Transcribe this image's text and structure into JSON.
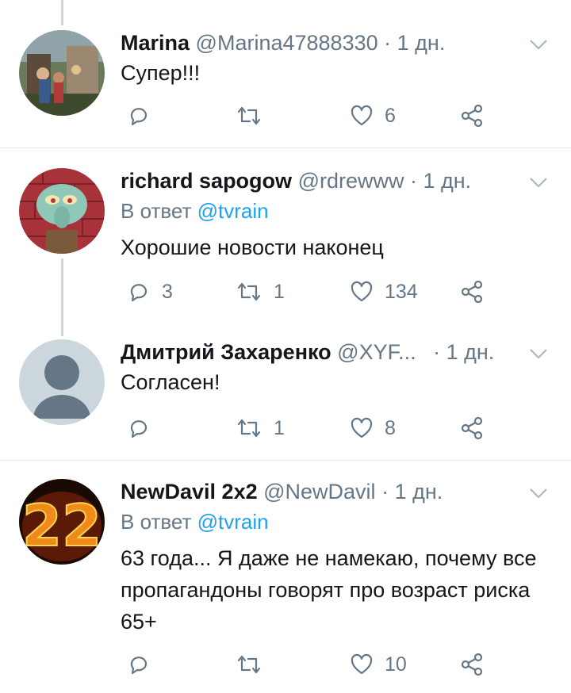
{
  "tweets": [
    {
      "name": "Marina",
      "handle": "@Marina47888330",
      "time": "· 1 дн.",
      "reply_prefix": "",
      "reply_to": "",
      "text": "Супер!!!",
      "replies": "",
      "retweets": "",
      "likes": "6"
    },
    {
      "name": "richard sapogow",
      "handle": "@rdrewww",
      "time": "· 1 дн.",
      "reply_prefix": "В ответ",
      "reply_to": "@tvrain",
      "text": "Хорошие новости наконец",
      "replies": "3",
      "retweets": "1",
      "likes": "134"
    },
    {
      "name": "Дмитрий Захаренко",
      "handle": "@XYF...",
      "time": "· 1 дн.",
      "reply_prefix": "",
      "reply_to": "",
      "text": "Согласен!",
      "replies": "",
      "retweets": "1",
      "likes": "8"
    },
    {
      "name": "NewDavil 2x2",
      "handle": "@NewDavil",
      "time": "· 1 дн.",
      "reply_prefix": "В ответ",
      "reply_to": "@tvrain",
      "text": "63 года... Я даже не намекаю, почему все пропагандоны говорят про возраст риска 65+",
      "replies": "",
      "retweets": "",
      "likes": "10"
    }
  ],
  "colors": {
    "text": "#14171a",
    "secondary": "#657786",
    "accent": "#1da1f2",
    "divider": "#e6ecf0"
  },
  "icons": [
    "reply-icon",
    "retweet-icon",
    "like-icon",
    "share-icon",
    "chevron-down-icon"
  ]
}
